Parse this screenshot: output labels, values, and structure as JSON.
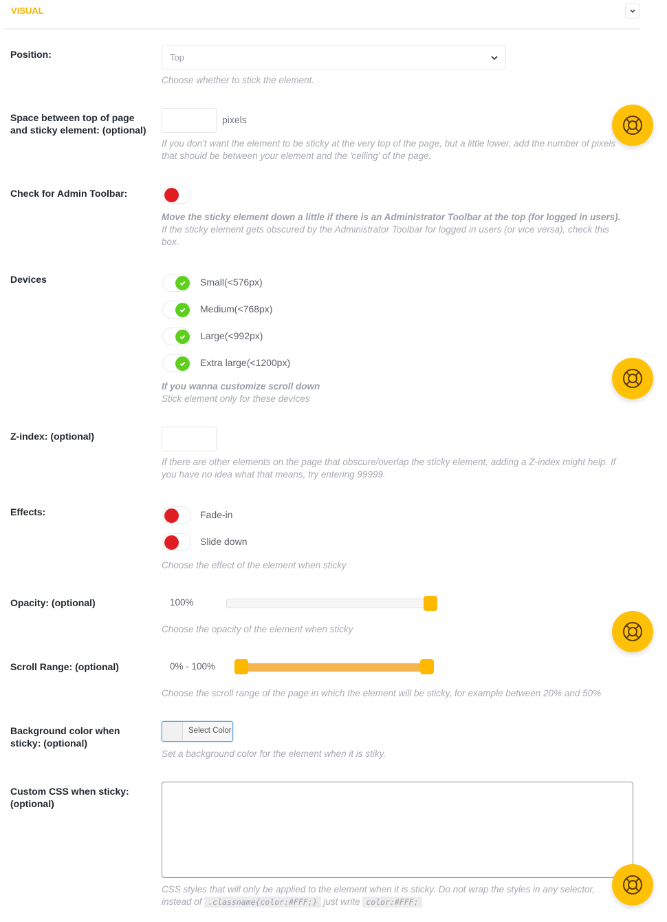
{
  "section": {
    "title": "VISUAL",
    "collapse_icon": "chevron-down-icon"
  },
  "position": {
    "label": "Position:",
    "selected": "Top",
    "description": "Choose whether to stick the element."
  },
  "space": {
    "label": "Space between top of page and sticky element: (optional)",
    "value": "",
    "unit": "pixels",
    "description": "If you don't want the element to be sticky at the very top of the page, but a little lower, add the number of pixels that should be between your element and the 'ceiling' of the page."
  },
  "admin_toolbar": {
    "label": "Check for Admin Toolbar:",
    "enabled": false,
    "description_bold": "Move the sticky element down a little if there is an Administrator Toolbar at the top (for logged in users).",
    "description": "If the sticky element gets obscured by the Administrator Toolbar for logged in users (or vice versa), check this box."
  },
  "devices": {
    "label": "Devices",
    "items": [
      {
        "label": "Small(<576px)",
        "enabled": true
      },
      {
        "label": "Medium(<768px)",
        "enabled": true
      },
      {
        "label": "Large(<992px)",
        "enabled": true
      },
      {
        "label": "Extra large(<1200px)",
        "enabled": true
      }
    ],
    "description_bold": "If you wanna customize scroll down",
    "description": "Stick element only for these devices"
  },
  "zindex": {
    "label": "Z-index: (optional)",
    "value": "",
    "description": "If there are other elements on the page that obscure/overlap the sticky element, adding a Z-index might help. If you have no idea what that means, try entering 99999."
  },
  "effects": {
    "label": "Effects:",
    "items": [
      {
        "label": "Fade-in",
        "enabled": false
      },
      {
        "label": "Slide down",
        "enabled": false
      }
    ],
    "description": "Choose the effect of the element when sticky"
  },
  "opacity": {
    "label": "Opacity: (optional)",
    "value_text": "100%",
    "value": 100,
    "description": "Choose the opacity of the element when sticky"
  },
  "scroll_range": {
    "label": "Scroll Range: (optional)",
    "value_text": "0% - 100%",
    "min": 0,
    "max": 100,
    "description": "Choose the scroll range of the page in which the element will be sticky, for example between 20% and 50%"
  },
  "bg_color": {
    "label": "Background color when sticky: (optional)",
    "button_label": "Select Color",
    "description": "Set a background color for the element when it is stiky."
  },
  "custom_css": {
    "label": "Custom CSS when sticky: (optional)",
    "value": "",
    "description_1": "CSS styles that will only be applied to the element when it is sticky. Do not wrap the styles in any selector, instead of",
    "code_1": ".classname{color:#FFF;}",
    "description_2": "just write",
    "code_2": "color:#FFF;"
  },
  "help_button": {
    "icon": "lifebuoy-icon"
  },
  "colors": {
    "accent": "#ffc107",
    "title": "#f5b400",
    "toggle_off": "#e11d24",
    "toggle_on": "#5fcf1e",
    "range_fill": "#f5b54c"
  }
}
